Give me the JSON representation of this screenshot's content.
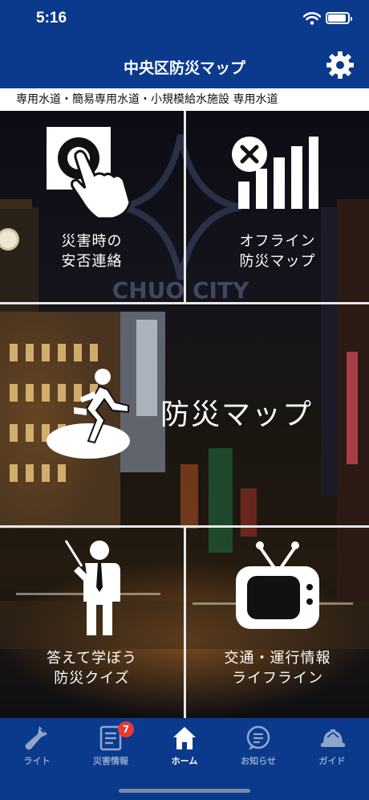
{
  "status": {
    "time": "5:16"
  },
  "header": {
    "title": "中央区防災マップ"
  },
  "ticker": {
    "text": "専用水道・簡易専用水道・小規模給水施設 専用水道"
  },
  "tiles": {
    "safety": {
      "line1": "災害時の",
      "line2": "安否連絡"
    },
    "offline": {
      "line1": "オフライン",
      "line2": "防災マップ"
    },
    "map": {
      "label": "防災マップ"
    },
    "quiz": {
      "line1": "答えて学ぼう",
      "line2": "防災クイズ"
    },
    "traffic": {
      "line1": "交通・運行情報",
      "line2": "ライフライン"
    }
  },
  "background": {
    "watermark": "CHUO CITY"
  },
  "tabs": [
    {
      "label": "ライト",
      "icon": "flashlight-icon"
    },
    {
      "label": "災害情報",
      "icon": "document-icon",
      "badge": "7"
    },
    {
      "label": "ホーム",
      "icon": "home-icon"
    },
    {
      "label": "お知らせ",
      "icon": "chat-bubble-icon"
    },
    {
      "label": "ガイド",
      "icon": "helmet-icon"
    }
  ],
  "colors": {
    "brand": "#0b3a8c",
    "badge": "#e53935",
    "tab_inactive": "#8fa6cc"
  }
}
